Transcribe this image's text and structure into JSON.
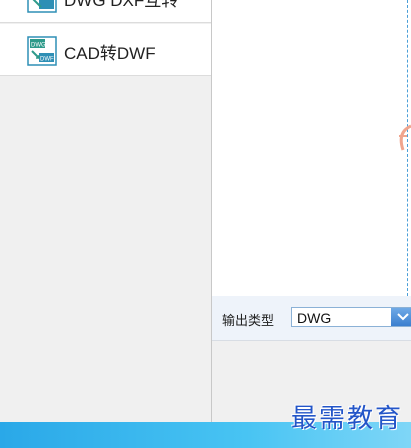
{
  "sidebar": {
    "items": [
      {
        "label": "DWG DXF互转",
        "icon": "dwg-dxf-convert-icon"
      },
      {
        "label": "CAD转DWF",
        "icon": "dwg-dwf-convert-icon"
      }
    ]
  },
  "output": {
    "label": "输出类型",
    "selected": "DWG"
  },
  "watermark": "最需教育",
  "colors": {
    "accent": "#3b7fcf",
    "taskbar": "#2aa8e8",
    "icon": "#2e9a8a"
  }
}
